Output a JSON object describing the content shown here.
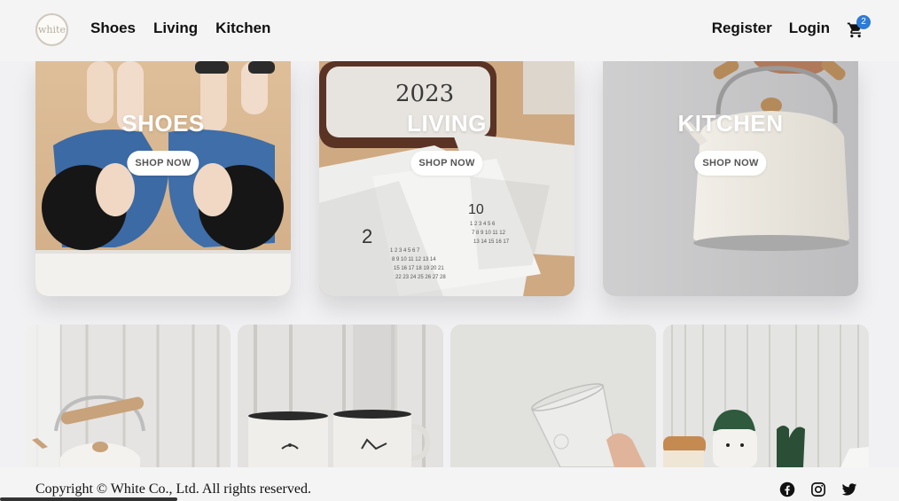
{
  "header": {
    "logo_text": "white",
    "nav_left": [
      {
        "label": "Shoes"
      },
      {
        "label": "Living"
      },
      {
        "label": "Kitchen"
      }
    ],
    "nav_right": [
      {
        "label": "Register"
      },
      {
        "label": "Login"
      }
    ],
    "cart_count": "2",
    "cart_icon": "shopping-cart-icon"
  },
  "categories": [
    {
      "title": "SHOES",
      "button": "SHOP NOW"
    },
    {
      "title": "LIVING",
      "button": "SHOP NOW"
    },
    {
      "title": "KITCHEN",
      "button": "SHOP NOW"
    }
  ],
  "products": [
    {
      "name": "kettle"
    },
    {
      "name": "enamel-mugs"
    },
    {
      "name": "glass-cup"
    },
    {
      "name": "plush-toys"
    }
  ],
  "footer": {
    "copyright": "Copyright © White Co., Ltd. All rights reserved.",
    "social_icons": [
      "facebook-icon",
      "instagram-icon",
      "twitter-icon"
    ]
  },
  "colors": {
    "accent": "#2e7bd6",
    "background": "#f1f1f3"
  }
}
